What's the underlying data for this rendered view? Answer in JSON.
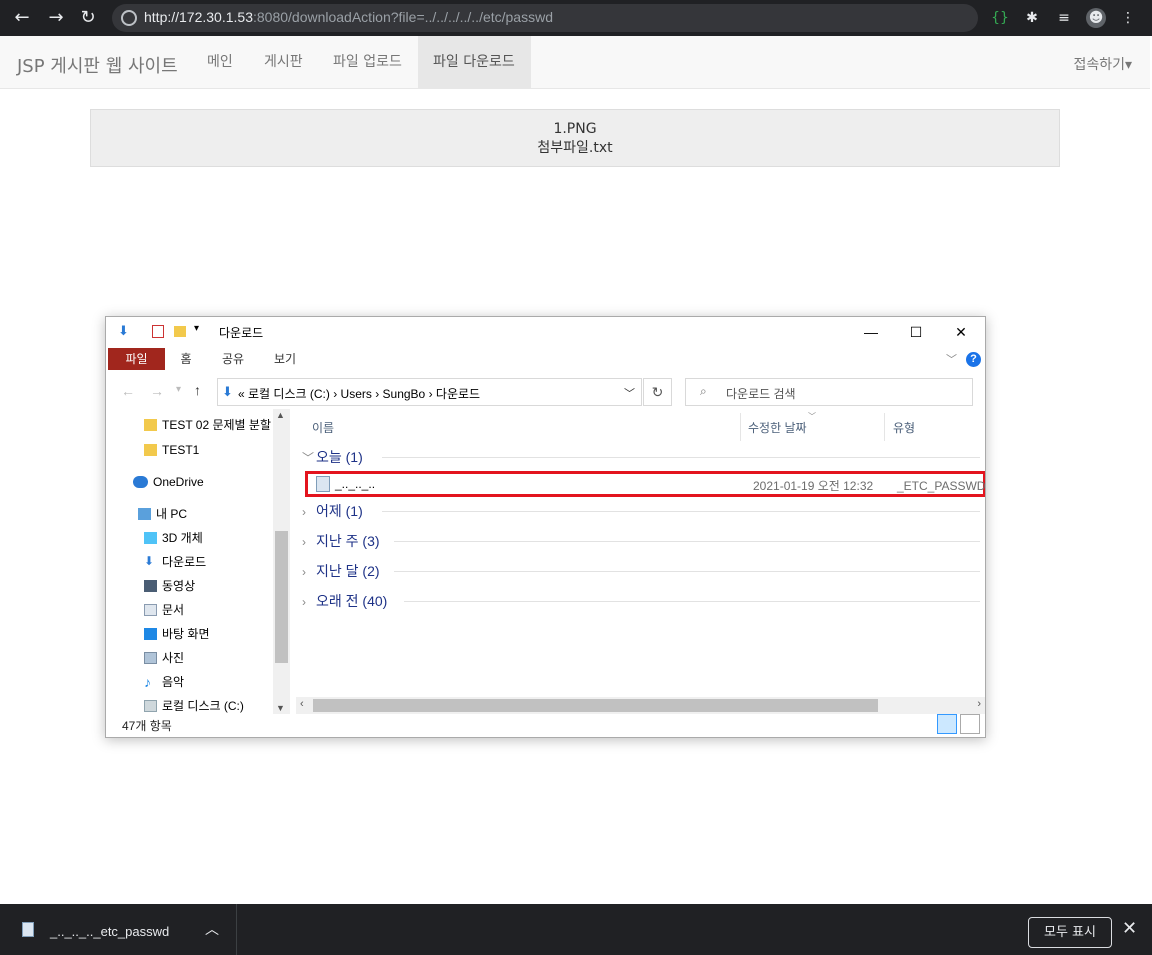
{
  "browser": {
    "url_host": "http://172.30.1.53",
    "url_rest": ":8080/downloadAction?file=../../../../../etc/passwd"
  },
  "navbar": {
    "brand": "JSP 게시판 웹 사이트",
    "links": [
      "메인",
      "게시판",
      "파일 업로드",
      "파일 다운로드"
    ],
    "active": "파일 다운로드",
    "login": "접속하기▾"
  },
  "files": [
    "1.PNG",
    "첨부파일.txt"
  ],
  "explorer": {
    "title": "다운로드",
    "ribbon_tabs": [
      "파일",
      "홈",
      "공유",
      "보기"
    ],
    "address": "«  로컬 디스크 (C:)  ›  Users  ›  SungBo  ›  다운로드",
    "search_placeholder": "다운로드 검색",
    "nav_items": [
      "TEST 02 문제별 분할",
      "TEST1",
      "OneDrive",
      "내 PC",
      "3D 개체",
      "다운로드",
      "동영상",
      "문서",
      "바탕 화면",
      "사진",
      "음악",
      "로컬 디스크 (C:)"
    ],
    "columns": [
      "이름",
      "수정한 날짜",
      "유형"
    ],
    "groups": [
      "오늘 (1)",
      "어제 (1)",
      "지난 주 (3)",
      "지난 달 (2)",
      "오래 전 (40)"
    ],
    "file_row": {
      "name": "_.._.._..",
      "date": "2021-01-19 오전 12:32",
      "type": "_ETC_PASSWD 파"
    },
    "status": "47개 항목"
  },
  "download_bar": {
    "filename": "_.._.._.._etc_passwd",
    "show_all": "모두 표시"
  },
  "colors": {
    "highlight_border": "#e3141e",
    "ribbon_file_tab": "#a1261d",
    "chrome_bg": "#202124"
  }
}
